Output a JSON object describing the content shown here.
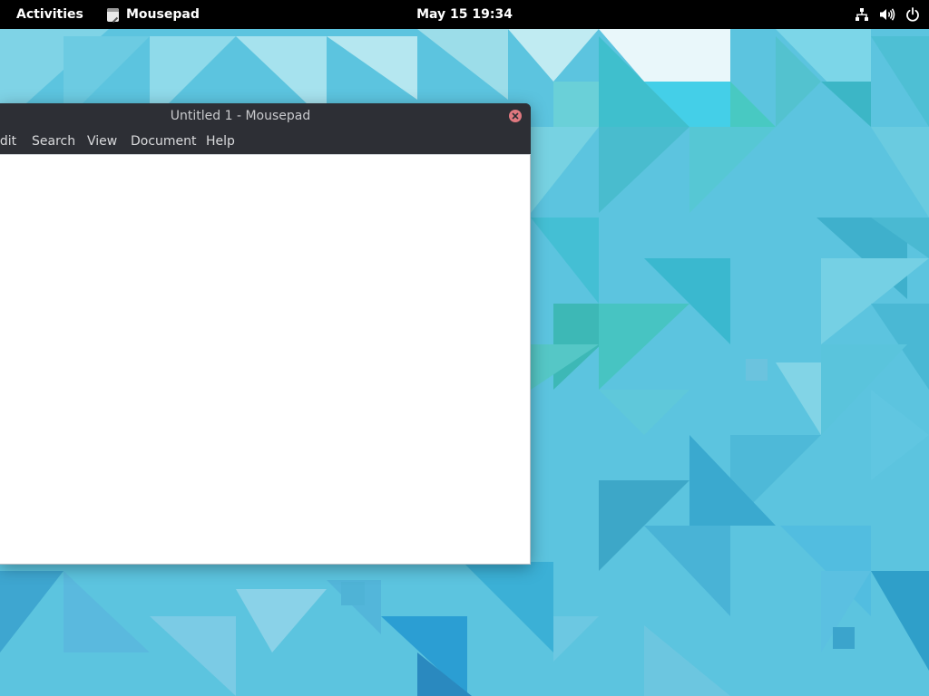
{
  "topbar": {
    "activities_label": "Activities",
    "app_name": "Mousepad",
    "clock": "May 15  19:34",
    "icons": [
      "network-icon",
      "volume-icon",
      "power-icon"
    ]
  },
  "window": {
    "title": "Untitled 1 - Mousepad",
    "menu": {
      "edit": "Edit",
      "search": "Search",
      "view": "View",
      "document": "Document",
      "help": "Help"
    },
    "editor_text": ""
  },
  "colors": {
    "topbar_bg": "#000000",
    "titlebar_bg": "#2d2f35",
    "close_button": "#e0787f",
    "desktop_bg": "#5cc4df"
  }
}
